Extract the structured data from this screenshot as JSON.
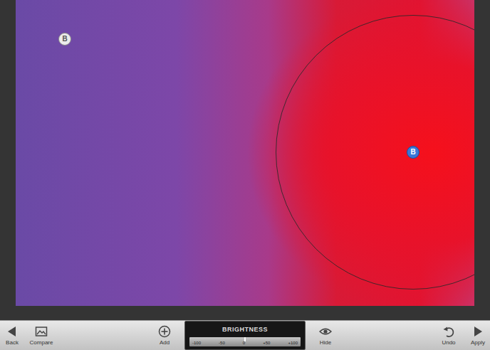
{
  "photo": {
    "control_points": [
      {
        "label": "B",
        "selected": false
      },
      {
        "label": "B",
        "selected": true
      }
    ]
  },
  "toolbar": {
    "back": {
      "label": "Back"
    },
    "compare": {
      "label": "Compare"
    },
    "add": {
      "label": "Add"
    },
    "adjust": {
      "title": "BRIGHTNESS",
      "ticks": [
        "-100",
        "-50",
        "0",
        "+50",
        "+100"
      ],
      "level": 0.5
    },
    "hide": {
      "label": "Hide"
    },
    "undo": {
      "label": "Undo"
    },
    "apply": {
      "label": "Apply"
    }
  }
}
